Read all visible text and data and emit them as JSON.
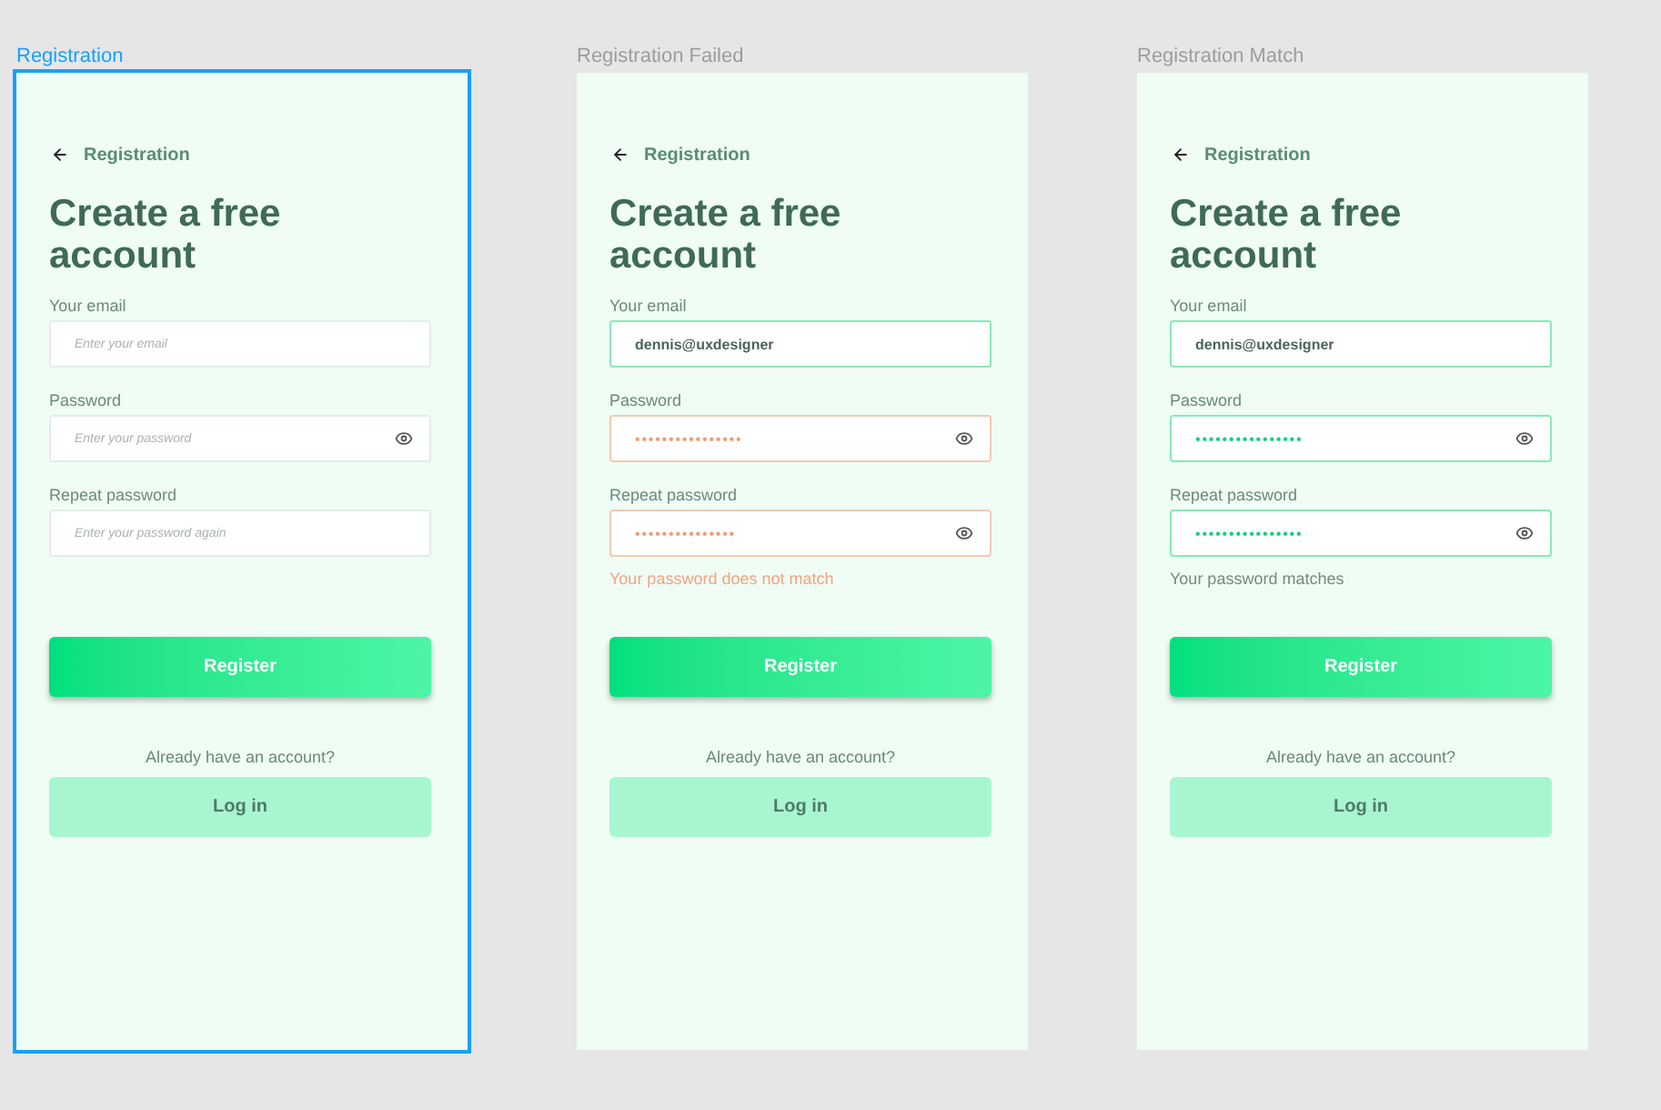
{
  "canvas": {
    "frames": [
      {
        "label": "Registration",
        "selected": true,
        "back_title": "Registration",
        "heading": "Create a free account",
        "fields": [
          {
            "label": "Your email",
            "kind": "email",
            "valid": false,
            "error": false,
            "placeholder": "Enter your email",
            "show_toggle": false
          },
          {
            "label": "Password",
            "kind": "password",
            "valid": false,
            "error": false,
            "placeholder": "Enter your password",
            "show_toggle": true
          },
          {
            "label": "Repeat password",
            "kind": "password",
            "valid": false,
            "error": false,
            "placeholder": "Enter your password again",
            "show_toggle": false
          }
        ],
        "register_button": "Register",
        "login_prompt": "Already have an account?",
        "login_button": "Log in"
      },
      {
        "label": "Registration Failed",
        "selected": false,
        "back_title": "Registration",
        "heading": "Create a free account",
        "fields": [
          {
            "label": "Your email",
            "kind": "email",
            "valid": true,
            "error": false,
            "value": "dennis@uxdesigner",
            "show_toggle": false
          },
          {
            "label": "Password",
            "kind": "password",
            "valid": false,
            "error": true,
            "value": "••••••••••••••••",
            "show_toggle": true
          },
          {
            "label": "Repeat password",
            "kind": "password",
            "valid": false,
            "error": true,
            "value": "•••••••••••••••",
            "show_toggle": true
          }
        ],
        "message": {
          "text": "Your password does not match",
          "error": true
        },
        "register_button": "Register",
        "login_prompt": "Already have an account?",
        "login_button": "Log in"
      },
      {
        "label": "Registration Match",
        "selected": false,
        "back_title": "Registration",
        "heading": "Create a free account",
        "fields": [
          {
            "label": "Your email",
            "kind": "email",
            "valid": true,
            "error": false,
            "value": "dennis@uxdesigner",
            "show_toggle": false
          },
          {
            "label": "Password",
            "kind": "password",
            "valid": true,
            "error": false,
            "value": "••••••••••••••••",
            "show_toggle": true
          },
          {
            "label": "Repeat password",
            "kind": "password",
            "valid": true,
            "error": false,
            "value": "••••••••••••••••",
            "show_toggle": true
          }
        ],
        "message": {
          "text": "Your password matches",
          "error": false
        },
        "register_button": "Register",
        "login_prompt": "Already have an account?",
        "login_button": "Log in"
      }
    ]
  }
}
